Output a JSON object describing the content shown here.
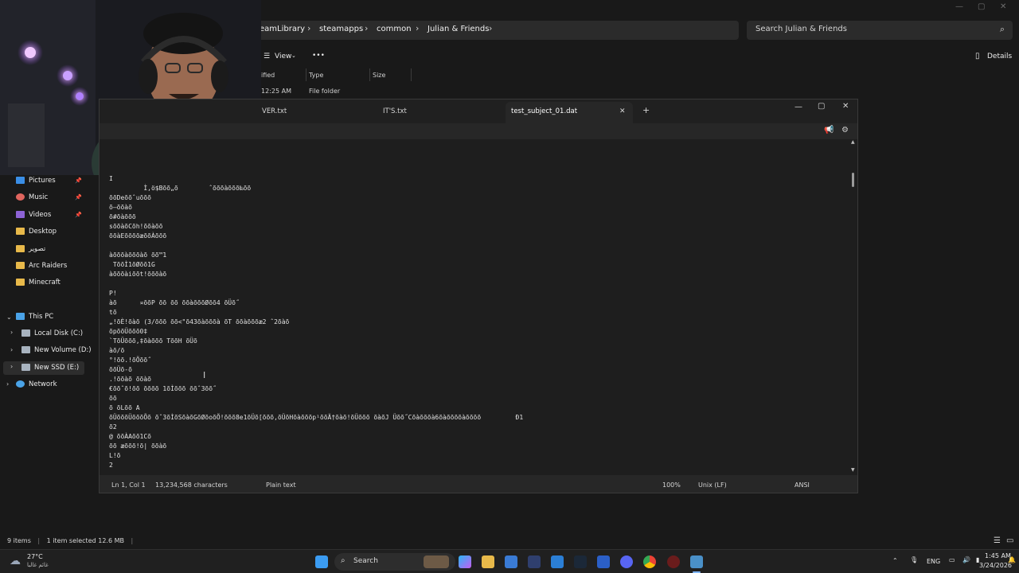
{
  "explorer": {
    "breadcrumbs": [
      "eamLibrary",
      "steamapps",
      "common",
      "Julian & Friends"
    ],
    "search_placeholder": "Search Julian & Friends",
    "toolbar": {
      "view_label": "View",
      "more_label": "•••",
      "details_label": "Details"
    },
    "columns": {
      "modified": "ified",
      "type": "Type",
      "size": "Size"
    },
    "row": {
      "modified": "12:25 AM",
      "type": "File folder"
    },
    "sidebar": {
      "pinned": [
        {
          "label": "Pictures",
          "icon": "pictures-icon"
        },
        {
          "label": "Music",
          "icon": "music-icon"
        },
        {
          "label": "Videos",
          "icon": "videos-icon"
        }
      ],
      "folders": [
        "Desktop",
        "تصوير",
        "Arc Raiders",
        "Minecraft"
      ],
      "this_pc": "This PC",
      "drives": [
        "Local Disk (C:)",
        "New Volume (D:)",
        "New SSD (E:)"
      ],
      "network": "Network"
    },
    "status": {
      "items": "9 items",
      "selected": "1 item selected  12.6 MB"
    }
  },
  "notepad": {
    "tabs": [
      {
        "label": "VER.txt"
      },
      {
        "label": "IT'S.txt"
      },
      {
        "label": "test_subject_01.dat",
        "active": true
      }
    ],
    "text_lines": [
      "I",
      "         Ì,ö$Bõõ„õ        ˆõõõàõõõ‰õõ",
      "õõDeõõˆuõõõ",
      "õ–õõàõ",
      "õ#õàõõõ",
      "sõõàõCõh!õõàõõ",
      "õõàEõõõõæõõÀõõõ",
      "",
      "àõõõàõõõàõ õõ™1",
      " TõõÌ1õØõõ1G",
      "àõõõàiõõt!õõõàõ",
      "",
      "P!",
      "àõ      ¤õõP õõ õõ õõàõõõØõõ4 õÜõ˝",
      "tõ",
      "„!õÈ!õàõ (3/õõõ õõ<\"õ43õàõõõà õT õõàõõõæ2 ˆ2õàõ",
      "õpõõÜõõõ0‡",
      "`TõÜõõõ,‡õàõõõ TõõH õÜõ",
      "àõ/õ",
      "°!õõ.!õÕõõ˝",
      "õõÜõ-õ",
      ".!õõàõ õõàõ",
      "€õõˆõ!õõ õõõõ 1õÌõõõ õõˆ3õõ˝",
      "õõ",
      "õ õLõõ A",
      "õÜõõõÜõõõÕõ õˆ3õÌõSõàõGõØõoõÕ!õõõ8e1õÜõ[õõõ,õÜõHõàõõõp¹õõÄ†õàõ!õÜõõõ õàõJ Üõõ˝Cõàõõõà6õàõõõõàõõõõ         Ð1",
      "õ2",
      "@ õõÀAõõ1Cõ",
      "õõ æõõõ!õ| õõàõ",
      "L!õ",
      "2"
    ],
    "status": {
      "position": "Ln 1, Col 1",
      "chars": "13,234,568 characters",
      "format": "Plain text",
      "zoom": "100%",
      "line_ending": "Unix (LF)",
      "encoding": "ANSI"
    }
  },
  "taskbar": {
    "weather_temp": "27°C",
    "weather_desc": "غائم غالبا",
    "search_label": "Search",
    "language": "ENG",
    "time": "1:45 AM",
    "date": "3/24/2026"
  }
}
